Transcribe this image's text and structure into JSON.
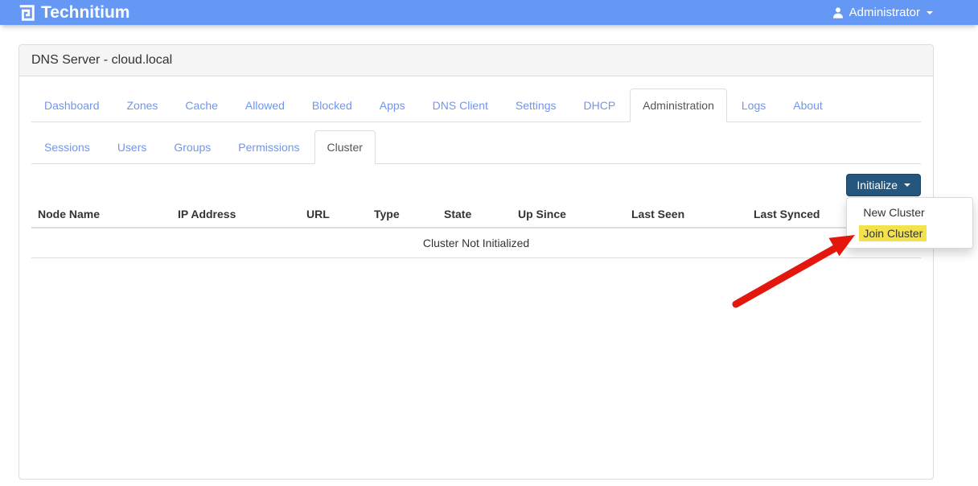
{
  "navbar": {
    "brand": "Technitium",
    "user_label": "Administrator"
  },
  "panel": {
    "title": "DNS Server - cloud.local"
  },
  "tabs": {
    "items": [
      "Dashboard",
      "Zones",
      "Cache",
      "Allowed",
      "Blocked",
      "Apps",
      "DNS Client",
      "Settings",
      "DHCP",
      "Administration",
      "Logs",
      "About"
    ],
    "active": "Administration"
  },
  "subtabs": {
    "items": [
      "Sessions",
      "Users",
      "Groups",
      "Permissions",
      "Cluster"
    ],
    "active": "Cluster"
  },
  "cluster": {
    "initialize_button": "Initialize",
    "menu": [
      "New Cluster",
      "Join Cluster"
    ],
    "highlighted_menu_item": "Join Cluster",
    "table_headers": [
      "Node Name",
      "IP Address",
      "URL",
      "Type",
      "State",
      "Up Since",
      "Last Seen",
      "Last Synced"
    ],
    "empty_message": "Cluster Not Initialized"
  },
  "colors": {
    "brand-blue": "#6598f5",
    "link-blue": "#6e96f3",
    "btn-navy": "#25567d",
    "highlight-yellow": "#f3e24b",
    "arrow-red": "#e3170d",
    "panel-heading-bg": "#f5f5f5",
    "border-gray": "#dddddd"
  }
}
